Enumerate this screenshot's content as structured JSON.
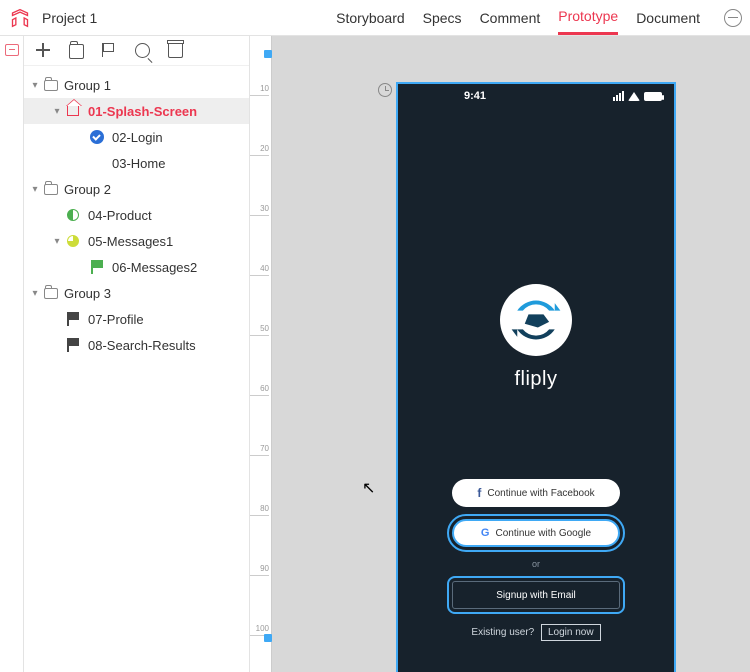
{
  "project_title": "Project 1",
  "tabs": {
    "storyboard": "Storyboard",
    "specs": "Specs",
    "comment": "Comment",
    "prototype": "Prototype",
    "document": "Document",
    "active": "prototype"
  },
  "tree": {
    "g1": {
      "label": "Group 1",
      "i1": {
        "label": "01-Splash-Screen"
      },
      "i2": {
        "label": "02-Login"
      },
      "i3": {
        "label": "03-Home"
      }
    },
    "g2": {
      "label": "Group 2",
      "i1": {
        "label": "04-Product"
      },
      "i2": {
        "label": "05-Messages1"
      },
      "i3": {
        "label": "06-Messages2"
      }
    },
    "g3": {
      "label": "Group 3",
      "i1": {
        "label": "07-Profile"
      },
      "i2": {
        "label": "08-Search-Results"
      }
    }
  },
  "ruler": {
    "t10": "10",
    "t20": "20",
    "t30": "30",
    "t40": "40",
    "t50": "50",
    "t60": "60",
    "t70": "70",
    "t80": "80",
    "t90": "90",
    "t100": "100"
  },
  "phone": {
    "time": "9:41",
    "brand": "fliply",
    "fb": "Continue with Facebook",
    "google": "Continue with Google",
    "or": "or",
    "email": "Signup with Email",
    "existing": "Existing user?",
    "login": "Login now"
  },
  "colors": {
    "accent": "#ec3750",
    "selection": "#3fa9f5"
  }
}
